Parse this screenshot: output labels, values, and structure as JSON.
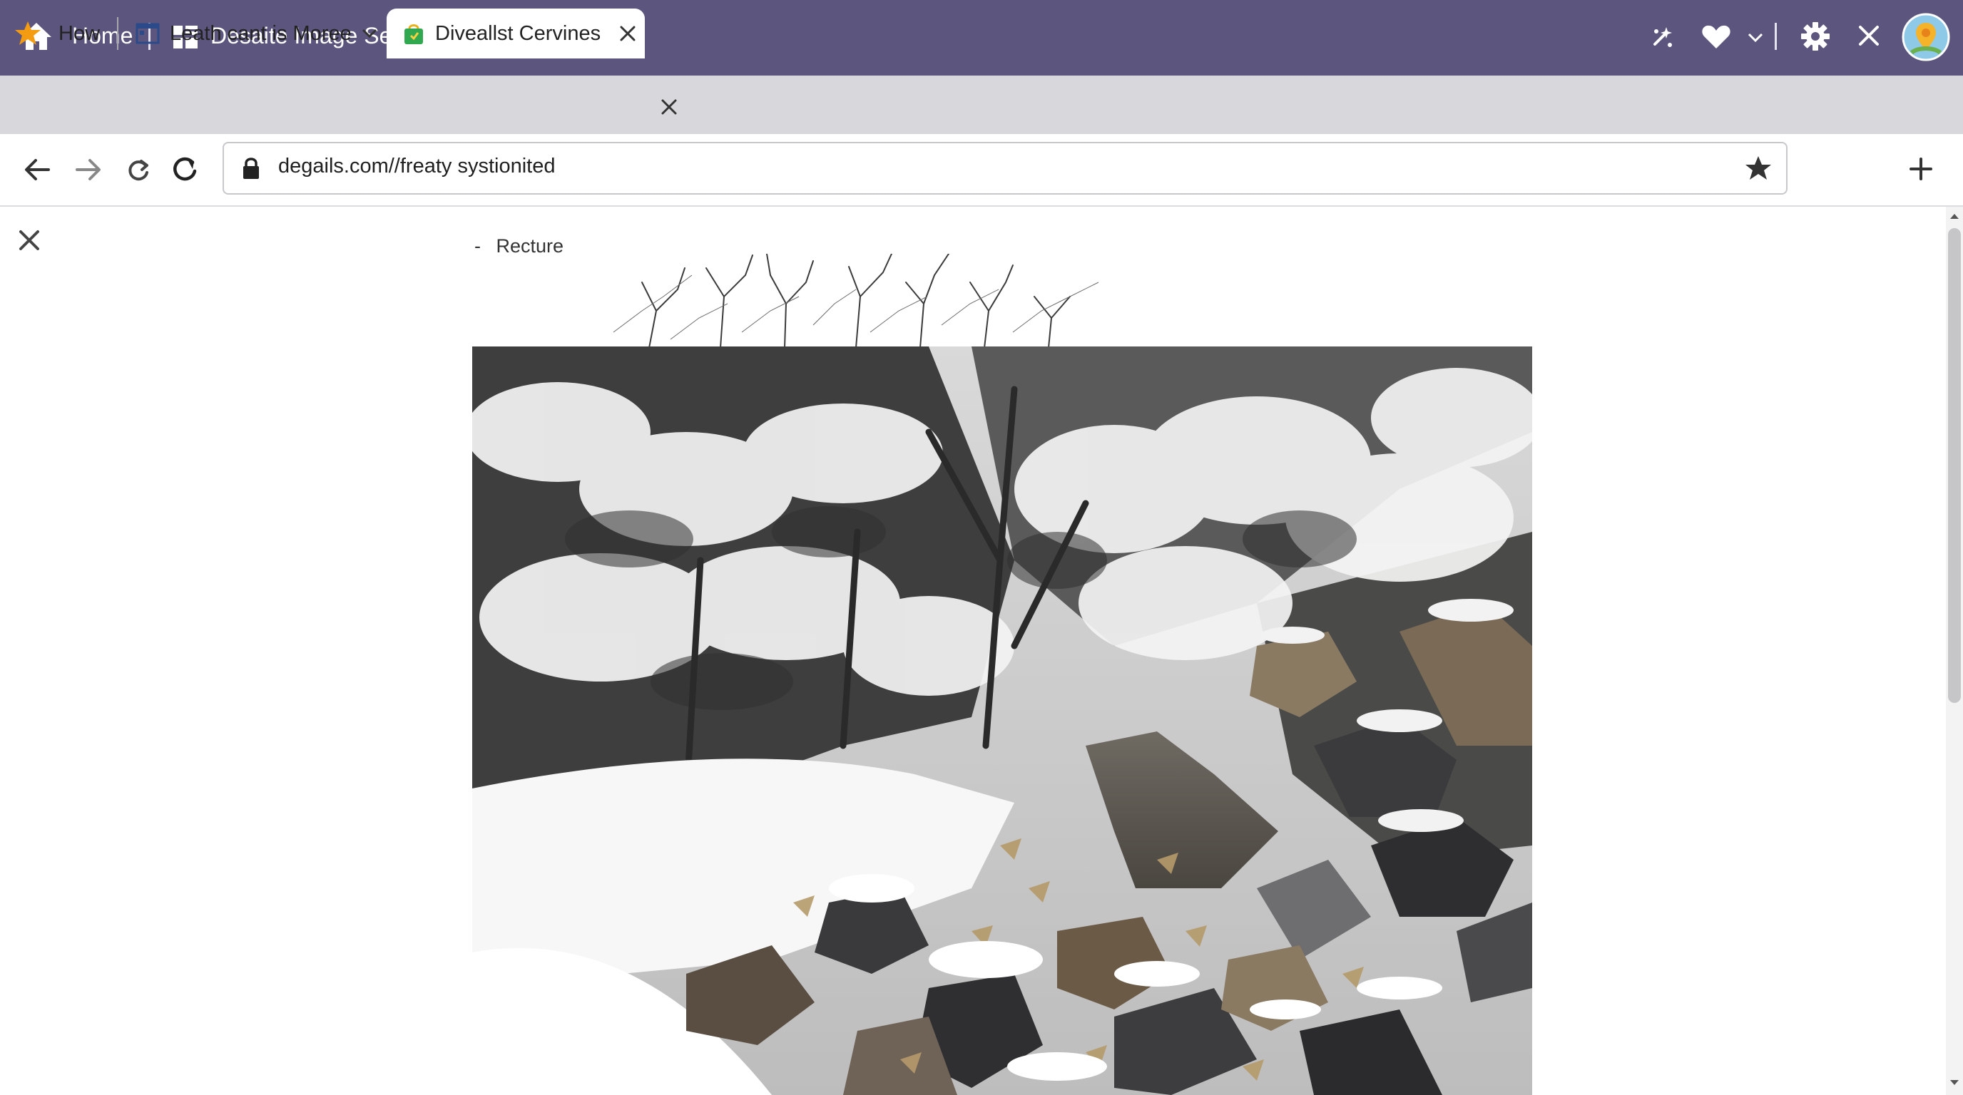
{
  "titlebar": {
    "home_label": "Home",
    "app_title": "Desaite Image Sett",
    "icons": [
      "home-icon",
      "app-grid-icon",
      "sparkle-icon",
      "heart-icon",
      "dropdown-arrow-icon",
      "gear-icon",
      "close-icon",
      "avatar"
    ]
  },
  "tabs": [
    {
      "label": "How",
      "icon": "star-icon"
    },
    {
      "label": "Leath cant is Moree",
      "icon": "window-icon",
      "has_dropdown": true
    },
    {
      "label": "Diveallst Cervines",
      "icon": "shopping-bag-icon",
      "active": true
    }
  ],
  "toolbar": {
    "url": "degails.com//freaty systionited",
    "icons": [
      "back-arrow-icon",
      "forward-arrow-icon",
      "refresh-icon",
      "reload-icon",
      "lock-icon",
      "bookmark-star-icon",
      "new-tab-plus-icon"
    ]
  },
  "content": {
    "caption_dash": "-",
    "caption": "Recture",
    "image_subject": "snowy forest stream with rocks and fallen leaves"
  },
  "colors": {
    "titlebar": "#5c557e",
    "tabstrip": "#d8d8dc",
    "active_tab": "#ffffff",
    "accent_orange": "#f39c12",
    "tab_icon_green": "#2fa84f"
  }
}
